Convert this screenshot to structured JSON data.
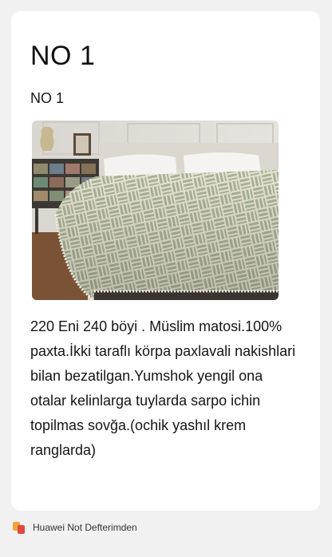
{
  "note": {
    "title": "NO 1",
    "subtitle": "NO 1",
    "description": "220 Eni 240 böyi . Müslim matosi.100% paxta.İkki taraflı körpa paxlavali nakishlari bilan bezatilgan.Yumshok yengil ona otalar kelinlarga tuylarda sarpo ichin topilmas sovğa.(ochik yashıl krem ranglarda)"
  },
  "footer": {
    "app_icon": "huawei-notepad-icon",
    "label": "Huawei Not Defterimden"
  },
  "colors": {
    "background": "#f1f1f1",
    "card": "#ffffff",
    "bedspread_green": "#aeb99a",
    "bedspread_cream": "#ece6d6"
  }
}
